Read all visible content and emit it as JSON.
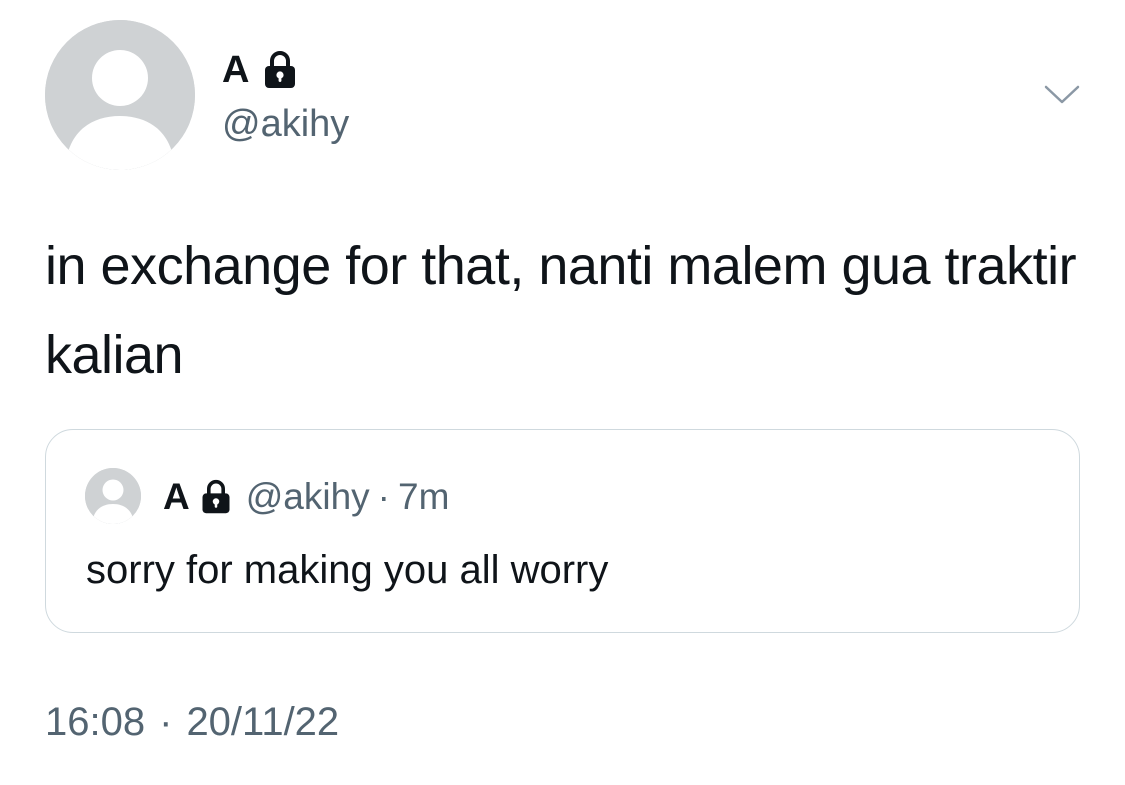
{
  "author": {
    "display_name": "A",
    "handle": "@akihy",
    "avatar_icon": "default-avatar-icon",
    "protected_icon": "lock-icon"
  },
  "tweet": {
    "text": "in exchange for that, nanti malem gua traktir kalian",
    "time": "16:08",
    "separator": "·",
    "date": "20/11/22"
  },
  "quoted_tweet": {
    "display_name": "A",
    "handle": "@akihy",
    "separator": "·",
    "age": "7m",
    "text": "sorry for making you all worry"
  },
  "colors": {
    "text_primary": "#0f1419",
    "text_secondary": "#536471",
    "border": "#cfd9de",
    "avatar_bg": "#cfd2d4"
  }
}
